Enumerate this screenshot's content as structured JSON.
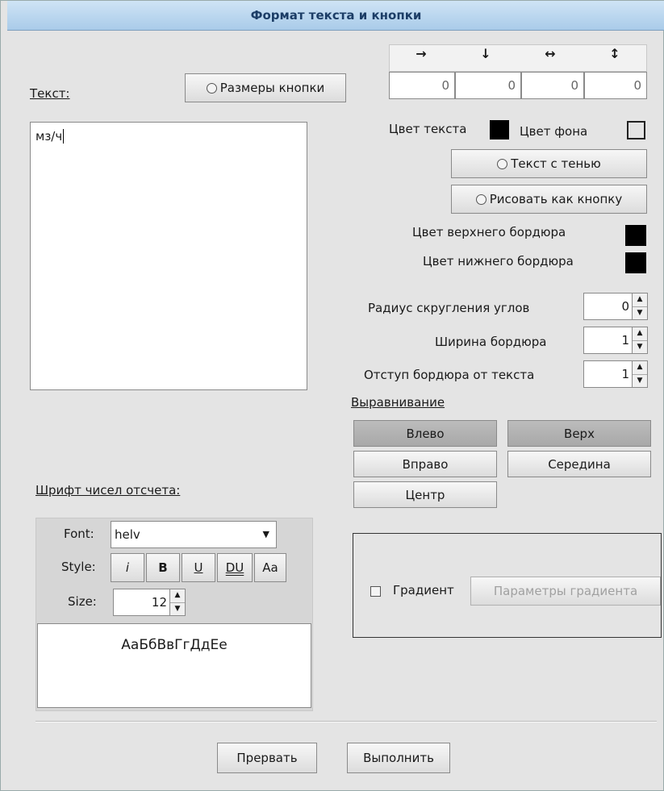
{
  "window": {
    "title": "Формат текста и кнопки"
  },
  "text_section": {
    "label": "Текст:",
    "value": "мз/ч"
  },
  "button_size": {
    "label": "Размеры кнопки",
    "arrows": [
      "→",
      "↓",
      "↔",
      "↕"
    ],
    "values": [
      "0",
      "0",
      "0",
      "0"
    ]
  },
  "colors": {
    "text_color_label": "Цвет текста",
    "text_color": "#000000",
    "bg_color_label": "Цвет фона",
    "bg_color": "#e4e4e4",
    "top_border_label": "Цвет верхнего бордюра",
    "top_border_color": "#000000",
    "bottom_border_label": "Цвет нижнего бордюра",
    "bottom_border_color": "#000000"
  },
  "toggles": {
    "shadow": "Текст с тенью",
    "draw_button": "Рисовать как кнопку"
  },
  "corner_radius": {
    "label": "Радиус скругления углов",
    "value": "0"
  },
  "border_width": {
    "label": "Ширина бордюра",
    "value": "1"
  },
  "border_padding": {
    "label": "Отступ бордюра от текста",
    "value": "1"
  },
  "alignment": {
    "label": "Выравнивание",
    "left": "Влево",
    "right": "Вправо",
    "center": "Центр",
    "top": "Верх",
    "middle": "Середина"
  },
  "font_section": {
    "label": "Шрифт чисел отсчета:",
    "font_label": "Font:",
    "font_value": "helv",
    "style_label": "Style:",
    "style_buttons": [
      "i",
      "B",
      "U",
      "DU",
      "Aa"
    ],
    "size_label": "Size:",
    "size_value": "12",
    "preview": "АаБбВвГгДдЕе"
  },
  "gradient": {
    "label": "Градиент",
    "params_button": "Параметры градиента",
    "checked": false
  },
  "footer": {
    "cancel": "Прервать",
    "ok": "Выполнить"
  }
}
